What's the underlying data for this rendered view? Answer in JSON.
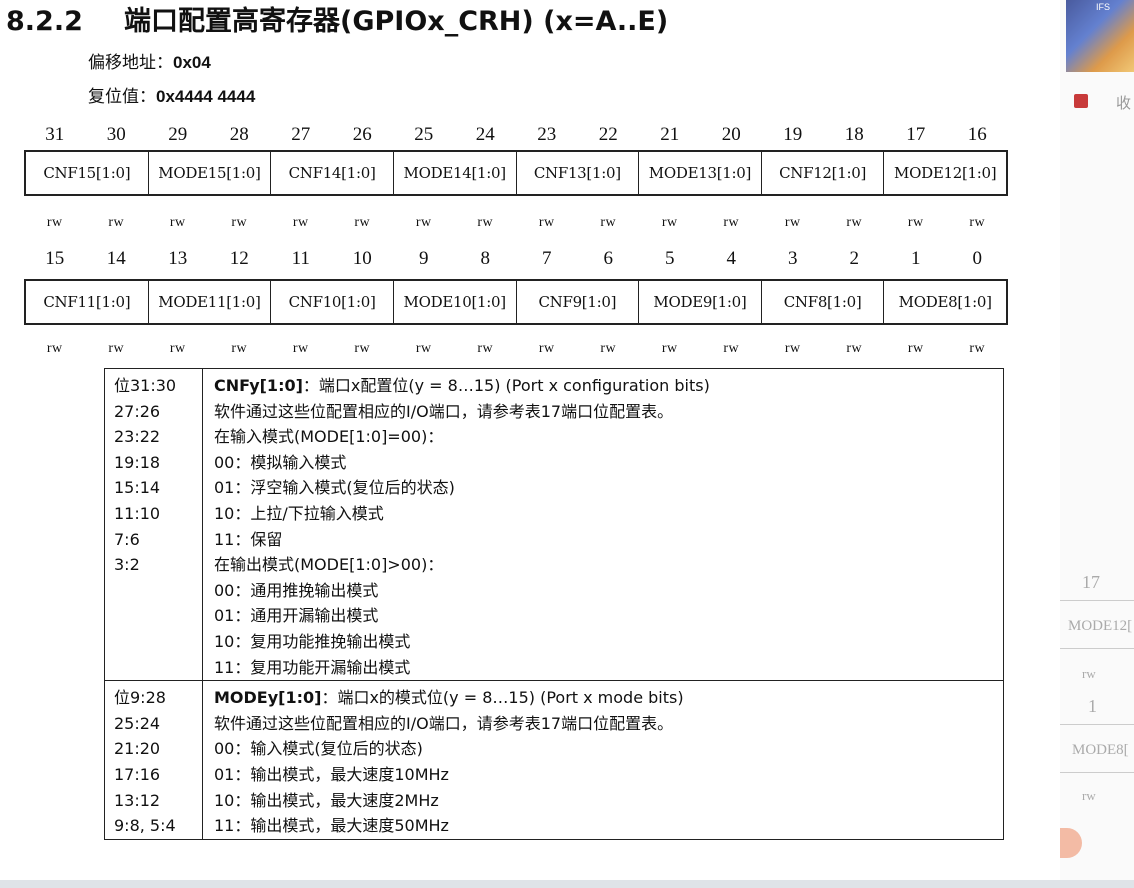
{
  "heading": {
    "number": "8.2.2",
    "title": "端口配置高寄存器(GPIOx_CRH) (x=A..E)"
  },
  "offset": {
    "label": "偏移地址：",
    "value": "0x04"
  },
  "reset": {
    "label": "复位值：",
    "value": "0x4444 4444"
  },
  "bits_high": [
    "31",
    "30",
    "29",
    "28",
    "27",
    "26",
    "25",
    "24",
    "23",
    "22",
    "21",
    "20",
    "19",
    "18",
    "17",
    "16"
  ],
  "fields_high": [
    "CNF15[1:0]",
    "MODE15[1:0]",
    "CNF14[1:0]",
    "MODE14[1:0]",
    "CNF13[1:0]",
    "MODE13[1:0]",
    "CNF12[1:0]",
    "MODE12[1:0]"
  ],
  "bits_low": [
    "15",
    "14",
    "13",
    "12",
    "11",
    "10",
    "9",
    "8",
    "7",
    "6",
    "5",
    "4",
    "3",
    "2",
    "1",
    "0"
  ],
  "fields_low": [
    "CNF11[1:0]",
    "MODE11[1:0]",
    "CNF10[1:0]",
    "MODE10[1:0]",
    "CNF9[1:0]",
    "MODE9[1:0]",
    "CNF8[1:0]",
    "MODE8[1:0]"
  ],
  "access": "rw",
  "desc": [
    {
      "bits": [
        "位31:30",
        "27:26",
        "23:22",
        "19:18",
        "15:14",
        "11:10",
        "7:6",
        "3:2"
      ],
      "title_bold": "CNFy[1:0]",
      "title_rest": "：端口x配置位(y = 8…15) (Port x configuration bits)",
      "lines": [
        "软件通过这些位配置相应的I/O端口，请参考表17端口位配置表。",
        "在输入模式(MODE[1:0]=00)：",
        "00：模拟输入模式",
        "01：浮空输入模式(复位后的状态)",
        "10：上拉/下拉输入模式",
        "11：保留",
        "在输出模式(MODE[1:0]>00)：",
        "00：通用推挽输出模式",
        "01：通用开漏输出模式",
        "10：复用功能推挽输出模式",
        "11：复用功能开漏输出模式"
      ]
    },
    {
      "bits": [
        "位9:28",
        "25:24",
        "21:20",
        "17:16",
        "13:12",
        "9:8, 5:4"
      ],
      "title_bold": "MODEy[1:0]",
      "title_rest": "：端口x的模式位(y = 8…15) (Port x mode bits)",
      "lines": [
        "软件通过这些位配置相应的I/O端口，请参考表17端口位配置表。",
        "00：输入模式(复位后的状态)",
        "01：输出模式，最大速度10MHz",
        "10：输出模式，最大速度2MHz",
        "11：输出模式，最大速度50MHz"
      ]
    }
  ],
  "side": {
    "thumb_label": "IFS",
    "fav_label": "收",
    "ghost_17": "17",
    "ghost_mode12": "MODE12[",
    "ghost_rw": "rw",
    "ghost_1": "1",
    "ghost_mode8": "MODE8["
  }
}
